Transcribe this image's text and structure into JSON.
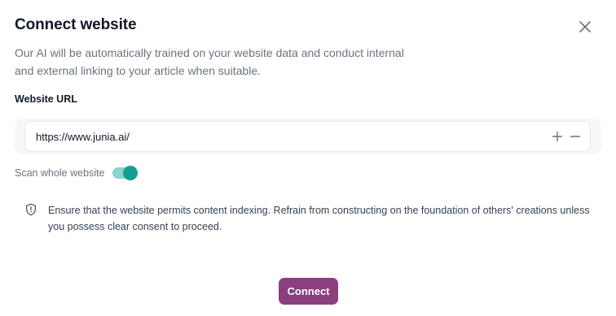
{
  "dialog": {
    "title": "Connect website",
    "description": "Our AI will be automatically trained on your website data and conduct internal and external linking to your article when suitable.",
    "close_icon": "close-icon"
  },
  "website_url": {
    "label": "Website URL",
    "value": "https://www.junia.ai/",
    "add_icon": "plus-icon",
    "remove_icon": "minus-icon"
  },
  "scan": {
    "label": "Scan whole website",
    "enabled": true,
    "color": "#14a090"
  },
  "notice": {
    "icon": "shield-icon",
    "text": "Ensure that the website permits content indexing. Refrain from constructing on the foundation of others' creations unless you possess clear consent to proceed."
  },
  "actions": {
    "connect_label": "Connect",
    "connect_color": "#8b3f7f"
  }
}
